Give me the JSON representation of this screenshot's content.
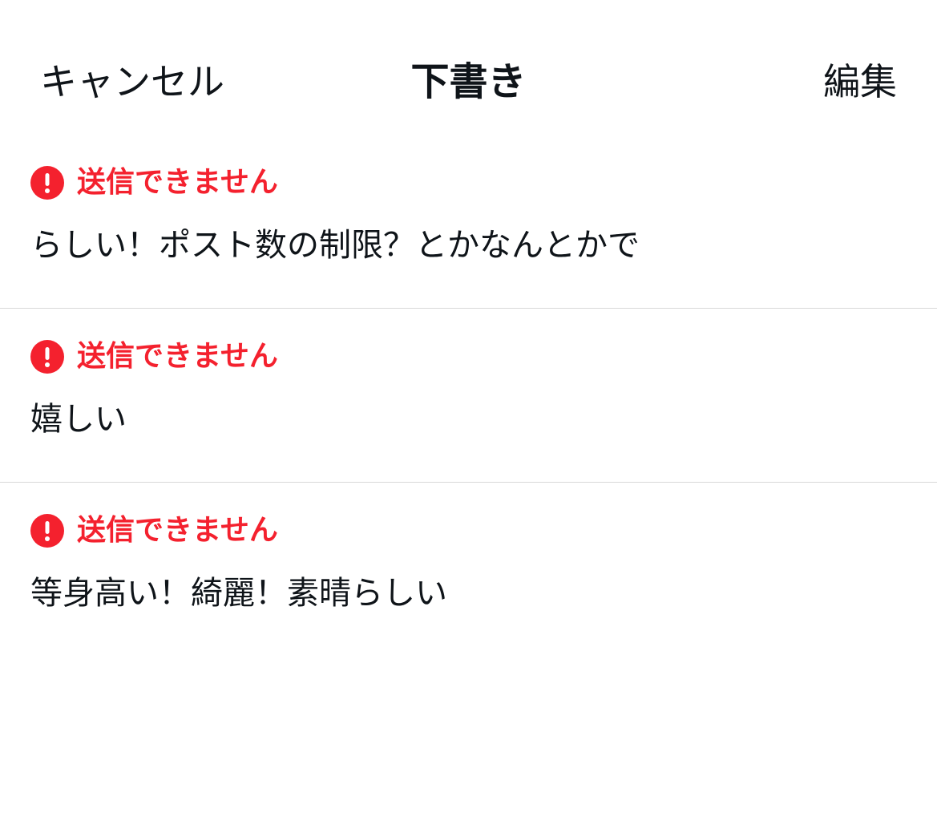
{
  "header": {
    "cancel_label": "キャンセル",
    "title": "下書き",
    "edit_label": "編集"
  },
  "colors": {
    "error": "#f4212e",
    "text": "#0f1419",
    "divider": "#d9d9d9"
  },
  "drafts": [
    {
      "status_icon": "exclamation-circle-icon",
      "status": "送信できません",
      "text": "らしい！ポスト数の制限？とかなんとかで"
    },
    {
      "status_icon": "exclamation-circle-icon",
      "status": "送信できません",
      "text": "嬉しい"
    },
    {
      "status_icon": "exclamation-circle-icon",
      "status": "送信できません",
      "text": "等身高い！綺麗！素晴らしい"
    }
  ]
}
